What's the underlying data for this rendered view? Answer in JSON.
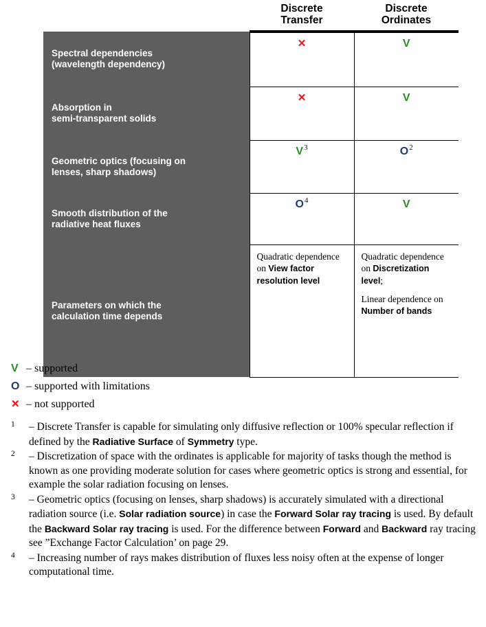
{
  "table": {
    "columns": [
      {
        "id": "feature",
        "header": ""
      },
      {
        "id": "discrete_transfer",
        "header_line1": "Discrete",
        "header_line2": "Transfer"
      },
      {
        "id": "discrete_ordinates",
        "header_line1": "Discrete",
        "header_line2": "Ordinates"
      }
    ],
    "rows": [
      {
        "label_line1": "Spectral dependencies",
        "label_line2": "(wavelength dependency)",
        "dt": {
          "symbol": "x",
          "glyph": "✕",
          "note": ""
        },
        "do": {
          "symbol": "v",
          "glyph": "V",
          "note": ""
        }
      },
      {
        "label_line1": "Absorption in",
        "label_line2": "semi-transparent solids",
        "dt": {
          "symbol": "x",
          "glyph": "✕",
          "note": ""
        },
        "do": {
          "symbol": "v",
          "glyph": "V",
          "note": ""
        }
      },
      {
        "label_line1": "Geometric optics (focusing on",
        "label_line2": "lenses, sharp shadows)",
        "dt": {
          "symbol": "v",
          "glyph": "V",
          "note": "3"
        },
        "do": {
          "symbol": "o",
          "glyph": "O",
          "note": "2"
        }
      },
      {
        "label_line1": "Smooth distribution of the",
        "label_line2": "radiative heat fluxes",
        "dt": {
          "symbol": "o",
          "glyph": "O",
          "note": "4"
        },
        "do": {
          "symbol": "v",
          "glyph": "V",
          "note": ""
        }
      }
    ],
    "last_row": {
      "label_line1": "Parameters on which the",
      "label_line2": "calculation time depends",
      "dt_paragraphs": [
        {
          "plain": "Quadratic dependence on ",
          "bold": "View factor resolution level",
          "tail": ""
        }
      ],
      "do_paragraphs": [
        {
          "plain": "Quadratic dependence on ",
          "bold": "Discretization level",
          "tail": ";"
        },
        {
          "plain": "Linear dependence on ",
          "bold": "Number of bands",
          "tail": ""
        }
      ]
    }
  },
  "legend": [
    {
      "symbol": "v",
      "glyph": "V",
      "text": "– supported"
    },
    {
      "symbol": "o",
      "glyph": "O",
      "text": "– supported with limitations"
    },
    {
      "symbol": "x",
      "glyph": "✕",
      "text": "– not supported"
    }
  ],
  "footnotes": [
    {
      "number": "1",
      "segments": [
        {
          "t": "– Discrete Transfer is capable for simulating only diffusive reflection or 100% specular reflection if defined by the ",
          "b": false
        },
        {
          "t": "Radiative Surface",
          "b": true
        },
        {
          "t": " of ",
          "b": false
        },
        {
          "t": "Symmetry",
          "b": true
        },
        {
          "t": " type.",
          "b": false
        }
      ]
    },
    {
      "number": "2",
      "segments": [
        {
          "t": "– Discretization of space with the ordinates is applicable for majority of tasks though the method is known as one providing moderate solution for cases where geometric optics is strong and essential, for example the solar radiation focusing on lenses.",
          "b": false
        }
      ]
    },
    {
      "number": "3",
      "segments": [
        {
          "t": "– Geometric optics (focusing on lenses, sharp shadows) is accurately simulated with a directional radiation source (i.e. ",
          "b": false
        },
        {
          "t": "Solar radiation source",
          "b": true
        },
        {
          "t": ") in case the ",
          "b": false
        },
        {
          "t": "Forward Solar ray tracing",
          "b": true
        },
        {
          "t": " is used. By default the ",
          "b": false
        },
        {
          "t": "Backward Solar ray tracing",
          "b": true
        },
        {
          "t": " is used. For the difference between ",
          "b": false
        },
        {
          "t": "Forward",
          "b": true
        },
        {
          "t": " and ",
          "b": false
        },
        {
          "t": "Backward",
          "b": true
        },
        {
          "t": " ray tracing see ”Exchange Factor Calculation’ on page 29.",
          "b": false
        }
      ]
    },
    {
      "number": "4",
      "segments": [
        {
          "t": "– Increasing number of rays makes distribution of fluxes less noisy often at the expense of longer computational time.",
          "b": false
        }
      ]
    }
  ],
  "colors": {
    "supported": "#2e8b23",
    "limited": "#1f3d7a",
    "not_supported": "#ee1111",
    "label_background": "#5e5e5e"
  }
}
